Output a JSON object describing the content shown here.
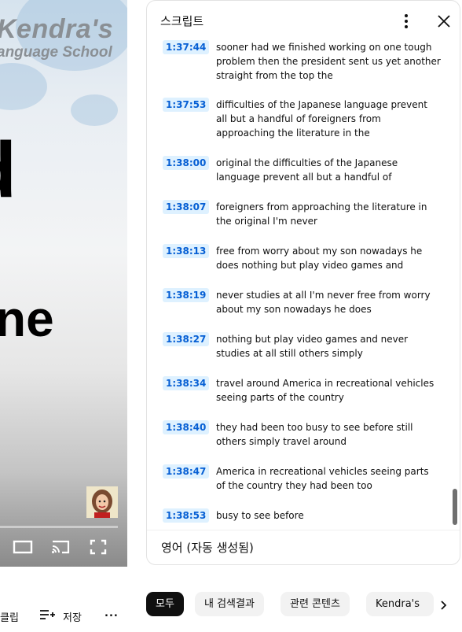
{
  "video": {
    "logo_line1": "Kendra's",
    "logo_line2": "anguage School",
    "big_text_1": "d",
    "big_text_2": "ne"
  },
  "below_video": {
    "clip_label": "클립",
    "save_label": "저장",
    "more_label": "..."
  },
  "transcript": {
    "title": "스크립트",
    "language": "영어 (자동 생성됨)",
    "segments": [
      {
        "time": "1:37:44",
        "text": "sooner had we finished working on one tough problem then the president sent us yet another straight from the top the"
      },
      {
        "time": "1:37:53",
        "text": "difficulties of the Japanese language prevent all but a handful of foreigners from approaching the literature in the"
      },
      {
        "time": "1:38:00",
        "text": "original the difficulties of the Japanese language prevent all but a handful of"
      },
      {
        "time": "1:38:07",
        "text": "foreigners from approaching the literature in the original I'm never"
      },
      {
        "time": "1:38:13",
        "text": "free from worry about my son nowadays he does nothing but play video games and"
      },
      {
        "time": "1:38:19",
        "text": "never studies at all I'm never free from worry about my son nowadays he does"
      },
      {
        "time": "1:38:27",
        "text": "nothing but play video games and never studies at all still others simply"
      },
      {
        "time": "1:38:34",
        "text": "travel around America in recreational vehicles seeing parts of the country"
      },
      {
        "time": "1:38:40",
        "text": "they had been too busy to see before still others simply travel around"
      },
      {
        "time": "1:38:47",
        "text": "America in recreational vehicles seeing parts of the country they had been too"
      },
      {
        "time": "1:38:53",
        "text": "busy to see before"
      }
    ]
  },
  "chips": [
    "모두",
    "내 검색결과",
    "관련 콘텐츠",
    "Kendra's"
  ],
  "colors": {
    "timestamp_bg": "#def1ff",
    "timestamp_fg": "#065fd4",
    "chip_active": "#0f0f0f"
  }
}
